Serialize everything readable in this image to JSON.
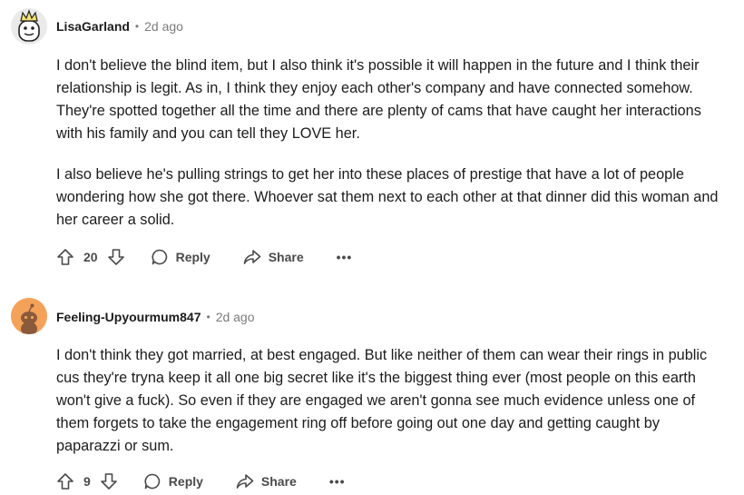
{
  "comments": [
    {
      "author": "LisaGarland",
      "separator": "•",
      "time": "2d ago",
      "paragraphs": [
        "I don't believe the blind item, but I also think it's possible it will happen in the future and I think their relationship is legit. As in, I think they enjoy each other's company and have connected somehow. They're spotted together all the time and there are plenty of cams that have caught her interactions with his family and you can tell they LOVE her.",
        "I also believe he's pulling strings to get her into these places of prestige that have a lot of people wondering how she got there. Whoever sat them next to each other at that dinner did this woman and her career a solid."
      ],
      "votes": "20",
      "reply_label": "Reply",
      "share_label": "Share",
      "more_label": "•••"
    },
    {
      "author": "Feeling-Upyourmum847",
      "separator": "•",
      "time": "2d ago",
      "paragraphs": [
        "I don't think they got married, at best engaged. But like neither of them can wear their rings in public cus they're tryna keep it all one big secret like it's the biggest thing ever (most people on this earth won't give a fuck). So even if they are engaged we aren't gonna see much evidence unless one of them forgets to take the engagement ring off before going out one day and getting caught by paparazzi or sum."
      ],
      "votes": "9",
      "reply_label": "Reply",
      "share_label": "Share",
      "more_label": "•••"
    }
  ],
  "icons": {
    "upvote": "arrow-up-icon",
    "downvote": "arrow-down-icon",
    "reply": "speech-bubble-icon",
    "share": "share-arrow-icon",
    "more": "ellipsis-icon"
  },
  "colors": {
    "text": "#1c1c1c",
    "meta": "#7c7c7c",
    "action": "#4a4a4a",
    "avatar2_bg": "#f4a259"
  }
}
